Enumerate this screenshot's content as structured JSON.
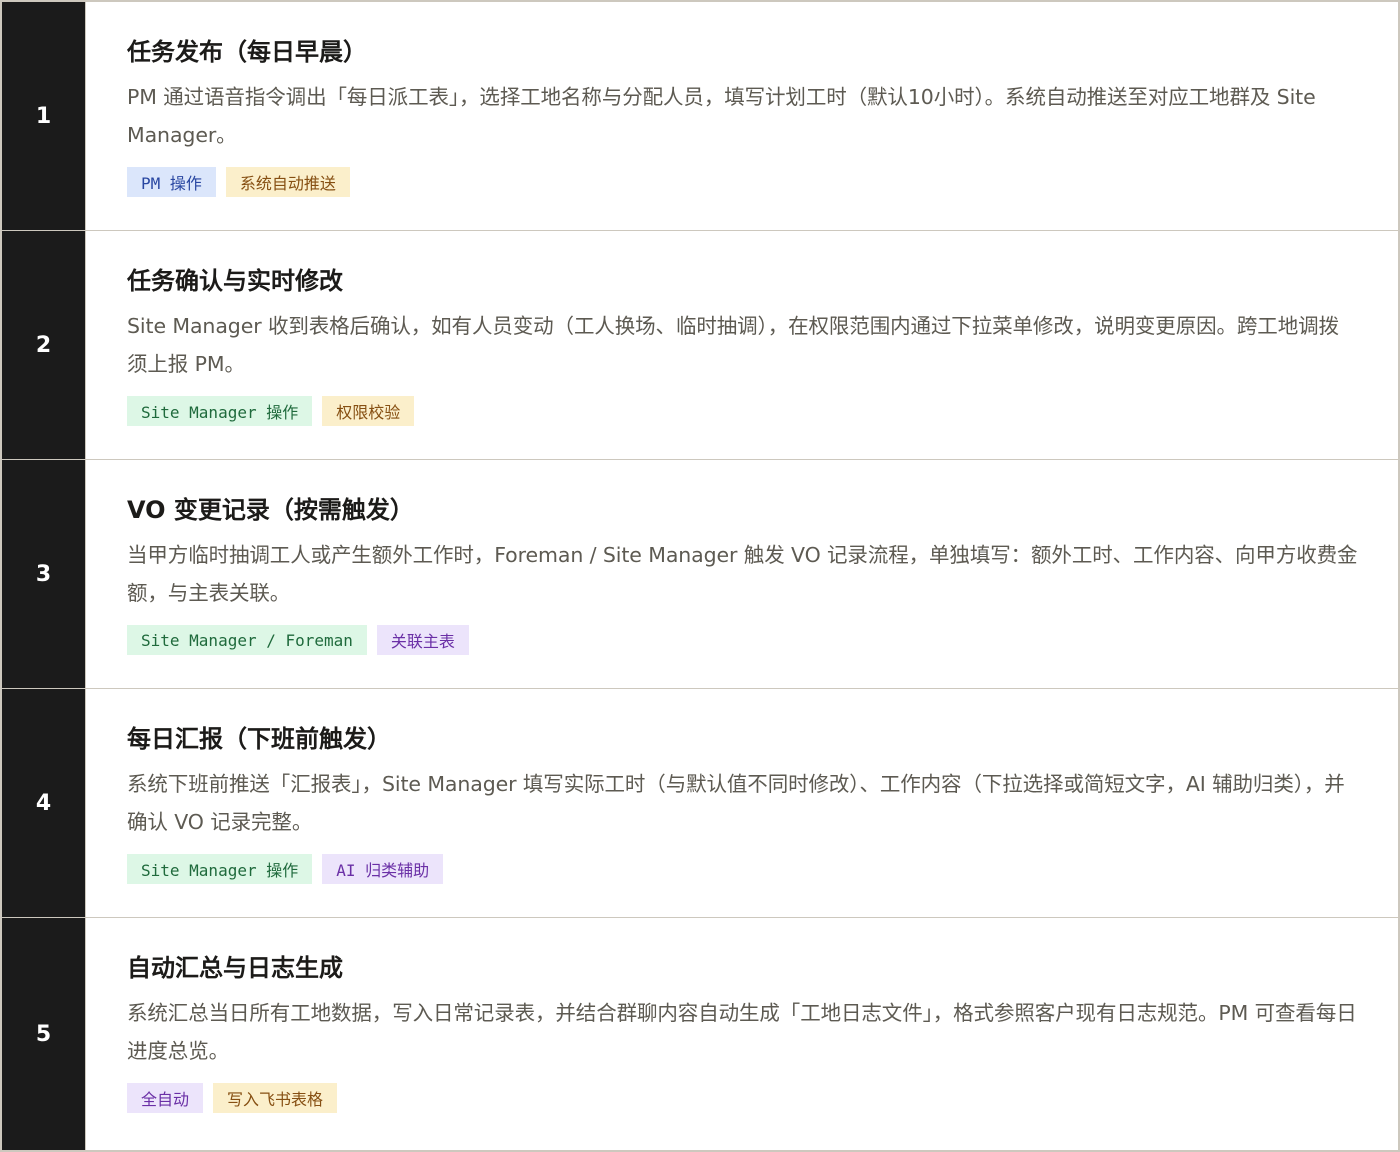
{
  "tag_colors": {
    "blue": {
      "background": "#dbe6fb",
      "text": "#2846a1"
    },
    "yellow": {
      "background": "#fbefcb",
      "text": "#864f12"
    },
    "green": {
      "background": "#ddf7e6",
      "text": "#1f6a3c"
    },
    "purple": {
      "background": "#ece4fb",
      "text": "#6a2fa6"
    }
  },
  "steps": [
    {
      "number": "1",
      "title": "任务发布（每日早晨）",
      "description": "PM 通过语音指令调出「每日派工表」，选择工地名称与分配人员，填写计划工时（默认10小时）。系统自动推送至对应工地群及 Site Manager。",
      "tags": [
        {
          "label": "PM 操作",
          "color": "blue"
        },
        {
          "label": "系统自动推送",
          "color": "yellow"
        }
      ]
    },
    {
      "number": "2",
      "title": "任务确认与实时修改",
      "description": "Site Manager 收到表格后确认，如有人员变动（工人换场、临时抽调），在权限范围内通过下拉菜单修改，说明变更原因。跨工地调拨须上报 PM。",
      "tags": [
        {
          "label": "Site Manager 操作",
          "color": "green"
        },
        {
          "label": "权限校验",
          "color": "yellow"
        }
      ]
    },
    {
      "number": "3",
      "title": "VO 变更记录（按需触发）",
      "description": "当甲方临时抽调工人或产生额外工作时，Foreman / Site Manager 触发 VO 记录流程，单独填写：额外工时、工作内容、向甲方收费金额，与主表关联。",
      "tags": [
        {
          "label": "Site Manager / Foreman",
          "color": "green"
        },
        {
          "label": "关联主表",
          "color": "purple"
        }
      ]
    },
    {
      "number": "4",
      "title": "每日汇报（下班前触发）",
      "description": "系统下班前推送「汇报表」，Site Manager 填写实际工时（与默认值不同时修改）、工作内容（下拉选择或简短文字，AI 辅助归类），并确认 VO 记录完整。",
      "tags": [
        {
          "label": "Site Manager 操作",
          "color": "green"
        },
        {
          "label": "AI 归类辅助",
          "color": "purple"
        }
      ]
    },
    {
      "number": "5",
      "title": "自动汇总与日志生成",
      "description": "系统汇总当日所有工地数据，写入日常记录表，并结合群聊内容自动生成「工地日志文件」，格式参照客户现有日志规范。PM 可查看每日进度总览。",
      "tags": [
        {
          "label": "全自动",
          "color": "purple"
        },
        {
          "label": "写入飞书表格",
          "color": "yellow"
        }
      ]
    }
  ]
}
